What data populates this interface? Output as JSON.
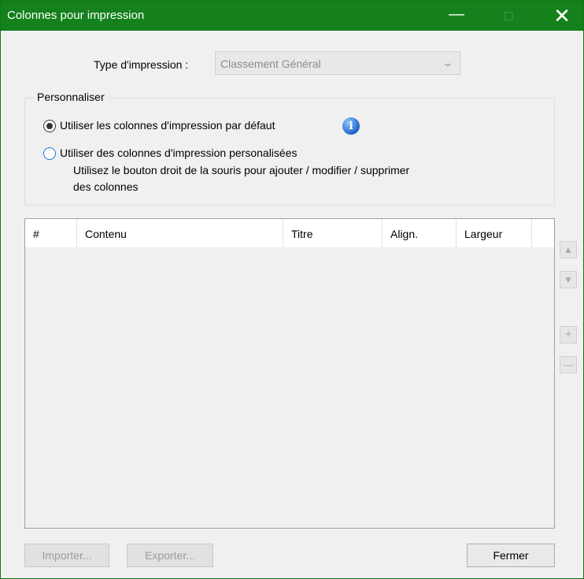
{
  "window": {
    "title": "Colonnes pour impression",
    "minimize": "—",
    "maximize": "□",
    "close": "✕"
  },
  "print_type": {
    "label": "Type d'impression :",
    "value": "Classement Général"
  },
  "customize": {
    "legend": "Personnaliser",
    "option_default": "Utiliser les colonnes d'impression par défaut",
    "option_custom": "Utiliser des colonnes d'impression personalisées",
    "hint_line1": "Utilisez le bouton droit de la souris pour ajouter / modifier / supprimer",
    "hint_line2": "des colonnes",
    "selected": "default"
  },
  "table": {
    "columns": [
      "#",
      "Contenu",
      "Titre",
      "Align.",
      "Largeur"
    ],
    "rows": []
  },
  "side_buttons": {
    "up": "▲",
    "down": "▼",
    "add": "+",
    "remove": "—"
  },
  "buttons": {
    "import": "Importer...",
    "export": "Exporter...",
    "close": "Fermer"
  },
  "colors": {
    "titlebar": "#14811c",
    "radio_accent": "#1a7ad6"
  }
}
